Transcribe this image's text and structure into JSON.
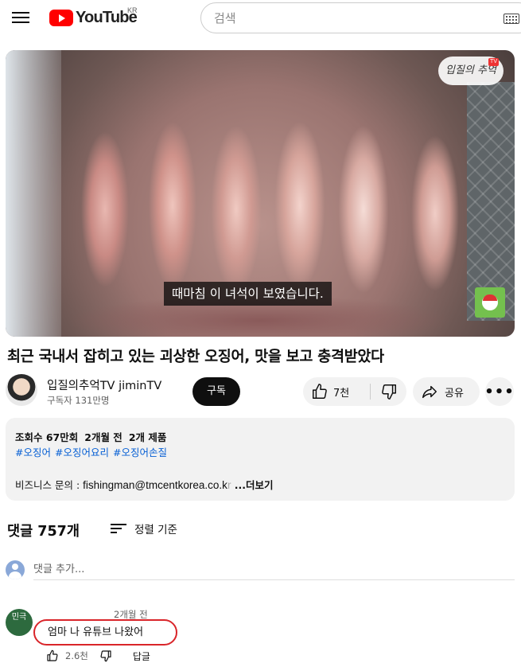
{
  "header": {
    "logo_text": "YouTube",
    "region": "KR",
    "search_placeholder": "검색"
  },
  "video": {
    "subtitle": "때마침 이 녀석이 보였습니다.",
    "watermark": "입질의 추억",
    "watermark_badge": "TV"
  },
  "title": "최근 국내서 잡히고 있는 괴상한 오징어, 맛을 보고 충격받았다",
  "channel": {
    "name": "입질의추억TV jiminTV",
    "subscribers": "구독자 131만명",
    "subscribe_label": "구독"
  },
  "actions": {
    "like_count": "7천",
    "share_label": "공유",
    "more_label": "•••"
  },
  "description": {
    "views": "조회수 67만회",
    "date": "2개월 전",
    "products": "2개 제품",
    "tags": [
      "#오징어",
      "#오징어요리",
      "#오징어손질"
    ],
    "business_prefix": "비즈니스 문의 : ",
    "business_email": "fishingman@tmcentkorea.co.k",
    "business_email_fade": "r",
    "more_label": " ...더보기"
  },
  "comments": {
    "count_label": "댓글 757개",
    "sort_label": "정렬 기준",
    "add_placeholder": "댓글 추가...",
    "items": [
      {
        "avatar_text": "민극",
        "time": "2개월 전",
        "text": "엄마 나 유튜브 나왔어",
        "like_count": "2.6천",
        "reply_label": "답글"
      }
    ]
  },
  "colors": {
    "brand_red": "#ff0000",
    "link_blue": "#065fd4",
    "highlight_circle": "#d9252a"
  }
}
